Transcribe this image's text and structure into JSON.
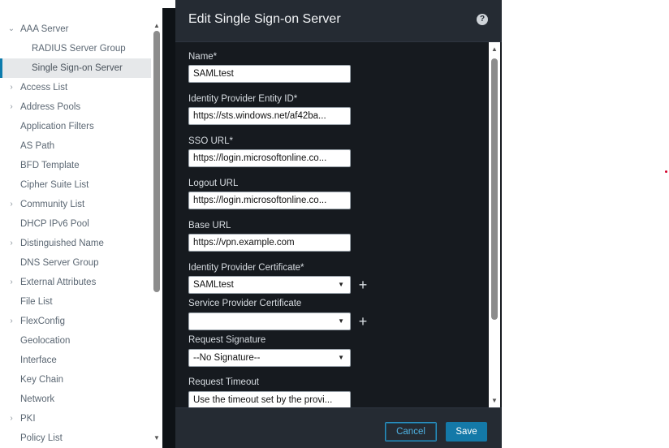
{
  "sidebar": {
    "items": [
      {
        "label": "AAA Server",
        "expanded": true
      },
      {
        "label": "RADIUS Server Group",
        "sub": true
      },
      {
        "label": "Single Sign-on Server",
        "sub": true,
        "selected": true
      },
      {
        "label": "Access List",
        "collapsed": true
      },
      {
        "label": "Address Pools",
        "collapsed": true
      },
      {
        "label": "Application Filters"
      },
      {
        "label": "AS Path"
      },
      {
        "label": "BFD Template"
      },
      {
        "label": "Cipher Suite List"
      },
      {
        "label": "Community List",
        "collapsed": true
      },
      {
        "label": "DHCP IPv6 Pool"
      },
      {
        "label": "Distinguished Name",
        "collapsed": true
      },
      {
        "label": "DNS Server Group"
      },
      {
        "label": "External Attributes",
        "collapsed": true
      },
      {
        "label": "File List"
      },
      {
        "label": "FlexConfig",
        "collapsed": true
      },
      {
        "label": "Geolocation"
      },
      {
        "label": "Interface"
      },
      {
        "label": "Key Chain"
      },
      {
        "label": "Network"
      },
      {
        "label": "PKI",
        "collapsed": true
      },
      {
        "label": "Policy List"
      }
    ]
  },
  "modal": {
    "title": "Edit Single Sign-on Server",
    "help_icon": "?",
    "fields": {
      "name": {
        "label": "Name*",
        "value": "SAMLtest"
      },
      "idp_entity_id": {
        "label": "Identity Provider Entity ID*",
        "value": "https://sts.windows.net/af42ba..."
      },
      "sso_url": {
        "label": "SSO URL*",
        "value": "https://login.microsoftonline.co..."
      },
      "logout_url": {
        "label": "Logout URL",
        "value": "https://login.microsoftonline.co..."
      },
      "base_url": {
        "label": "Base URL",
        "value": "https://vpn.example.com"
      },
      "idp_certificate": {
        "label": "Identity Provider Certificate*",
        "value": "SAMLtest"
      },
      "sp_certificate": {
        "label": "Service Provider Certificate",
        "value": ""
      },
      "request_signature": {
        "label": "Request Signature",
        "value": "--No Signature--"
      },
      "request_timeout": {
        "label": "Request Timeout",
        "value": "Use the timeout set by the provi..."
      }
    },
    "buttons": {
      "cancel": "Cancel",
      "save": "Save"
    }
  },
  "colors": {
    "accent": "#1479a8",
    "modal_bg": "#161a1f",
    "header_bg": "#252b33",
    "selected_marker": "#0d7cad"
  }
}
